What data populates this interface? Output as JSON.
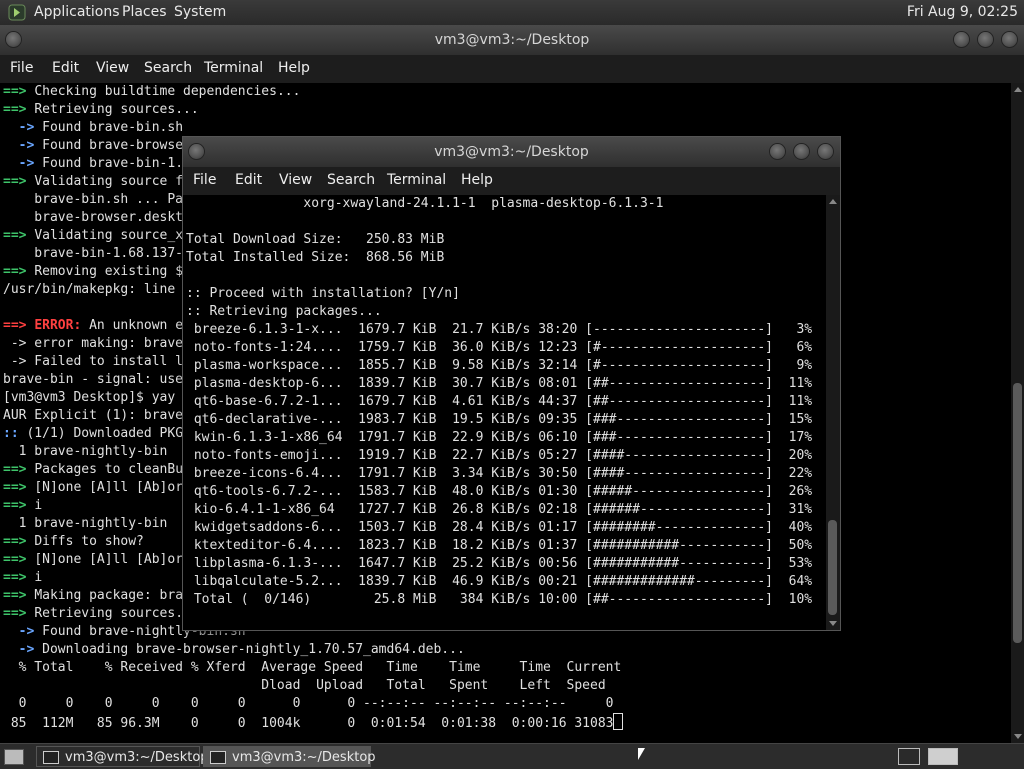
{
  "top_panel": {
    "menus": [
      "Applications",
      "Places",
      "System"
    ],
    "clock": "Fri Aug  9, 02:25"
  },
  "main_window": {
    "title": "vm3@vm3:~/Desktop",
    "menu": [
      "File",
      "Edit",
      "View",
      "Search",
      "Terminal",
      "Help"
    ],
    "lines": [
      [
        {
          "t": "==> ",
          "c": "g"
        },
        {
          "t": "Checking buildtime dependencies...",
          "c": "b"
        }
      ],
      [
        {
          "t": "==> ",
          "c": "g"
        },
        {
          "t": "Retrieving sources...",
          "c": "b"
        }
      ],
      [
        {
          "t": "  -> ",
          "c": "bl"
        },
        {
          "t": "Found brave-bin.sh",
          "c": "b"
        }
      ],
      [
        {
          "t": "  -> ",
          "c": "bl"
        },
        {
          "t": "Found brave-browse",
          "c": "b"
        }
      ],
      [
        {
          "t": "  -> ",
          "c": "bl"
        },
        {
          "t": "Found brave-bin-1.",
          "c": "b"
        }
      ],
      [
        {
          "t": "==> ",
          "c": "g"
        },
        {
          "t": "Validating source f",
          "c": "b"
        }
      ],
      [
        {
          "t": "    brave-bin.sh ... Pa",
          "c": ""
        }
      ],
      [
        {
          "t": "    brave-browser.deskt",
          "c": ""
        }
      ],
      [
        {
          "t": "==> ",
          "c": "g"
        },
        {
          "t": "Validating source_x",
          "c": "b"
        }
      ],
      [
        {
          "t": "    brave-bin-1.68.137-",
          "c": ""
        }
      ],
      [
        {
          "t": "==> ",
          "c": "g"
        },
        {
          "t": "Removing existing $",
          "c": "b"
        }
      ],
      [
        {
          "t": "/usr/bin/makepkg: line",
          "c": ""
        }
      ],
      [
        {
          "t": "",
          "c": ""
        }
      ],
      [
        {
          "t": "==> ",
          "c": "r"
        },
        {
          "t": "ERROR: ",
          "c": "r"
        },
        {
          "t": "An unknown e",
          "c": "b"
        }
      ],
      [
        {
          "t": " -> error making: brave",
          "c": ""
        }
      ],
      [
        {
          "t": " -> Failed to install l",
          "c": ""
        }
      ],
      [
        {
          "t": "brave-bin - signal: use",
          "c": ""
        }
      ],
      [
        {
          "t": "[vm3@vm3 Desktop]$ yay",
          "c": ""
        }
      ],
      [
        {
          "t": "AUR Explicit (1): brave",
          "c": ""
        }
      ],
      [
        {
          "t": ":: ",
          "c": "bl"
        },
        {
          "t": "(1/1) Downloaded PKG",
          "c": "b"
        }
      ],
      [
        {
          "t": "  1 brave-nightly-bin",
          "c": ""
        }
      ],
      [
        {
          "t": "==> ",
          "c": "g"
        },
        {
          "t": "Packages to cleanBu",
          "c": ""
        }
      ],
      [
        {
          "t": "==> ",
          "c": "g"
        },
        {
          "t": "[N]one [A]ll [Ab]or",
          "c": ""
        }
      ],
      [
        {
          "t": "==> ",
          "c": "g"
        },
        {
          "t": "i",
          "c": ""
        }
      ],
      [
        {
          "t": "  1 brave-nightly-bin",
          "c": ""
        }
      ],
      [
        {
          "t": "==> ",
          "c": "g"
        },
        {
          "t": "Diffs to show?",
          "c": ""
        }
      ],
      [
        {
          "t": "==> ",
          "c": "g"
        },
        {
          "t": "[N]one [A]ll [Ab]or",
          "c": ""
        }
      ],
      [
        {
          "t": "==> ",
          "c": "g"
        },
        {
          "t": "i",
          "c": ""
        }
      ],
      [
        {
          "t": "==> ",
          "c": "g"
        },
        {
          "t": "Making package: bra",
          "c": "b"
        }
      ],
      [
        {
          "t": "==> ",
          "c": "g"
        },
        {
          "t": "Retrieving sources.",
          "c": "b"
        }
      ],
      [
        {
          "t": "  -> ",
          "c": "bl"
        },
        {
          "t": "Found brave-nightly-bin.sh",
          "c": "b"
        }
      ],
      [
        {
          "t": "  -> ",
          "c": "bl"
        },
        {
          "t": "Downloading brave-browser-nightly_1.70.57_amd64.deb...",
          "c": "b"
        }
      ],
      [
        {
          "t": "  % Total    % Received % Xferd  Average Speed   Time    Time     Time  Current",
          "c": ""
        }
      ],
      [
        {
          "t": "                                 Dload  Upload   Total   Spent    Left  Speed",
          "c": ""
        }
      ],
      [
        {
          "t": "  0     0    0     0    0     0      0      0 --:--:-- --:--:-- --:--:--     0",
          "c": ""
        }
      ],
      [
        {
          "t": " 85  112M   85 96.3M    0     0  1004k      0  0:01:54  0:01:38  0:00:16 31083",
          "c": ""
        }
      ]
    ]
  },
  "second_window": {
    "title": "vm3@vm3:~/Desktop",
    "menu": [
      "File",
      "Edit",
      "View",
      "Search",
      "Terminal",
      "Help"
    ],
    "lines": [
      "               xorg-xwayland-24.1.1-1  plasma-desktop-6.1.3-1",
      "",
      "Total Download Size:   250.83 MiB",
      "Total Installed Size:  868.56 MiB",
      "",
      ":: Proceed with installation? [Y/n]",
      ":: Retrieving packages...",
      " breeze-6.1.3-1-x...  1679.7 KiB  21.7 KiB/s 38:20 [----------------------]   3%",
      " noto-fonts-1:24....  1759.7 KiB  36.0 KiB/s 12:23 [#---------------------]   6%",
      " plasma-workspace...  1855.7 KiB  9.58 KiB/s 32:14 [#---------------------]   9%",
      " plasma-desktop-6...  1839.7 KiB  30.7 KiB/s 08:01 [##--------------------]  11%",
      " qt6-base-6.7.2-1...  1679.7 KiB  4.61 KiB/s 44:37 [##--------------------]  11%",
      " qt6-declarative-...  1983.7 KiB  19.5 KiB/s 09:35 [###-------------------]  15%",
      " kwin-6.1.3-1-x86_64  1791.7 KiB  22.9 KiB/s 06:10 [###-------------------]  17%",
      " noto-fonts-emoji...  1919.7 KiB  22.7 KiB/s 05:27 [####------------------]  20%",
      " breeze-icons-6.4...  1791.7 KiB  3.34 KiB/s 30:50 [####------------------]  22%",
      " qt6-tools-6.7.2-...  1583.7 KiB  48.0 KiB/s 01:30 [#####-----------------]  26%",
      " kio-6.4.1-1-x86_64   1727.7 KiB  26.8 KiB/s 02:18 [######----------------]  31%",
      " kwidgetsaddons-6...  1503.7 KiB  28.4 KiB/s 01:17 [########--------------]  40%",
      " ktexteditor-6.4....  1823.7 KiB  18.2 KiB/s 01:37 [###########-----------]  50%",
      " libplasma-6.1.3-...  1647.7 KiB  25.2 KiB/s 00:56 [###########-----------]  53%",
      " libqalculate-5.2...  1839.7 KiB  46.9 KiB/s 00:21 [#############---------]  64%",
      " Total (  0/146)        25.8 MiB   384 KiB/s 10:00 [##--------------------]  10%"
    ]
  },
  "taskbar": {
    "tasks": [
      "vm3@vm3:~/Desktop",
      "vm3@vm3:~/Desktop"
    ]
  }
}
